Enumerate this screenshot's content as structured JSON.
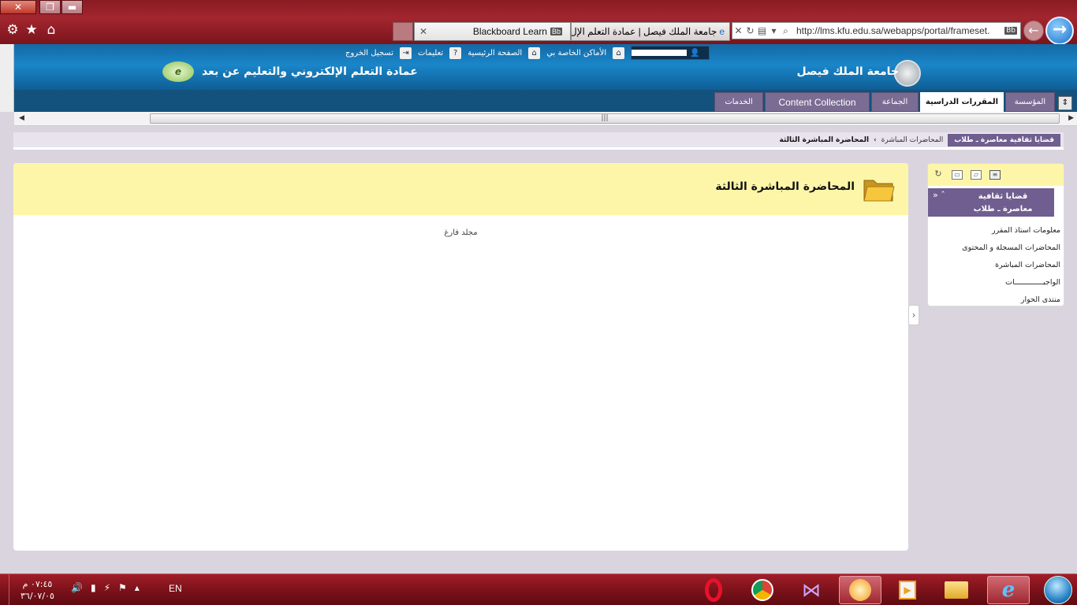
{
  "browser": {
    "close": "✕",
    "restore": "❐",
    "minimize": "▬",
    "url": "http://lms.kfu.edu.sa/webapps/portal/frameset.",
    "tab1_title": "جامعة الملك فيصل | عمادة التعلم الإل...",
    "tab2_title": "Blackboard Learn",
    "tab_badge": "Bb"
  },
  "header": {
    "user_name": "",
    "my_places": "الأماكن الخاصة بي",
    "home": "الصفحة الرئيسية",
    "help": "تعليمات",
    "logout": "تسجيل الخروج",
    "university": "جامعة الملك فيصل",
    "deanship": "عمادة التعلم الإلكتروني والتعليم عن بعد",
    "logo_text": "e"
  },
  "tabs": [
    {
      "label": "المؤسسة"
    },
    {
      "label": "المقررات الدراسية"
    },
    {
      "label": "الجماعة"
    },
    {
      "label": "Content Collection"
    },
    {
      "label": "الخدمات"
    }
  ],
  "breadcrumb": {
    "course": "قضايا ثقافية معاصرة ـ طلاب",
    "parent": "المحاضرات المباشرة",
    "separator": "›",
    "current": "المحاضرة المباشرة الثالثة"
  },
  "content": {
    "title": "المحاضرة المباشرة الثالثة",
    "empty_message": "مجلد فارغ"
  },
  "course_menu": {
    "title_line1": "قضايا ثقافية",
    "title_line2": "معاصرة ـ طلاب",
    "items": [
      {
        "label": "معلومات استاذ المقرر"
      },
      {
        "label": "المحاضرات المسجلة و المحتوى"
      },
      {
        "label": "المحاضرات المباشرة"
      },
      {
        "label": "الواجبـــــــــــــات"
      },
      {
        "label": "منتدى الحوار"
      }
    ]
  },
  "taskbar": {
    "language": "EN",
    "time": "٠٧:٤٥ م",
    "date": "٣٦/٠٧/٠٥"
  },
  "colors": {
    "accent_purple": "#6f5e8f",
    "header_yellow": "#fdf6a9",
    "chrome_red": "#8a1a22"
  }
}
